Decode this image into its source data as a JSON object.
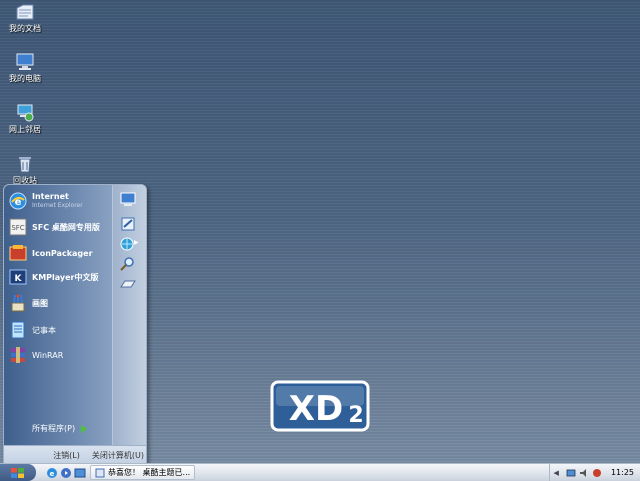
{
  "desktop": {
    "icons": [
      {
        "label": "我的文档",
        "icon": "documents-icon"
      },
      {
        "label": "我的电脑",
        "icon": "computer-icon"
      },
      {
        "label": "网上邻居",
        "icon": "network-icon"
      },
      {
        "label": "回收站",
        "icon": "recycle-bin-icon"
      }
    ]
  },
  "start_menu": {
    "pinned": [
      {
        "label": "Internet",
        "sub": "Internet Explorer",
        "icon": "ie-icon"
      },
      {
        "label": "SFC 桌酷网专用版",
        "icon": "sfc-icon"
      },
      {
        "label": "IconPackager",
        "icon": "iconpackager-icon"
      },
      {
        "label": "KMPlayer中文版",
        "icon": "kmplayer-icon"
      },
      {
        "label": "画图",
        "icon": "paint-icon"
      },
      {
        "label": "记事本",
        "icon": "notepad-icon"
      },
      {
        "label": "WinRAR",
        "icon": "winrar-icon"
      }
    ],
    "all_programs": "所有程序(P)",
    "logoff": "注销(L)",
    "shutdown": "关闭计算机(U)"
  },
  "logo": {
    "text": "XD",
    "sub": "2"
  },
  "taskbar": {
    "task_label": "恭喜您！ 桌酷主题已...",
    "clock": "11:25"
  },
  "colors": {
    "accent": "#3f5f8c",
    "desktop": "#4e6683"
  }
}
